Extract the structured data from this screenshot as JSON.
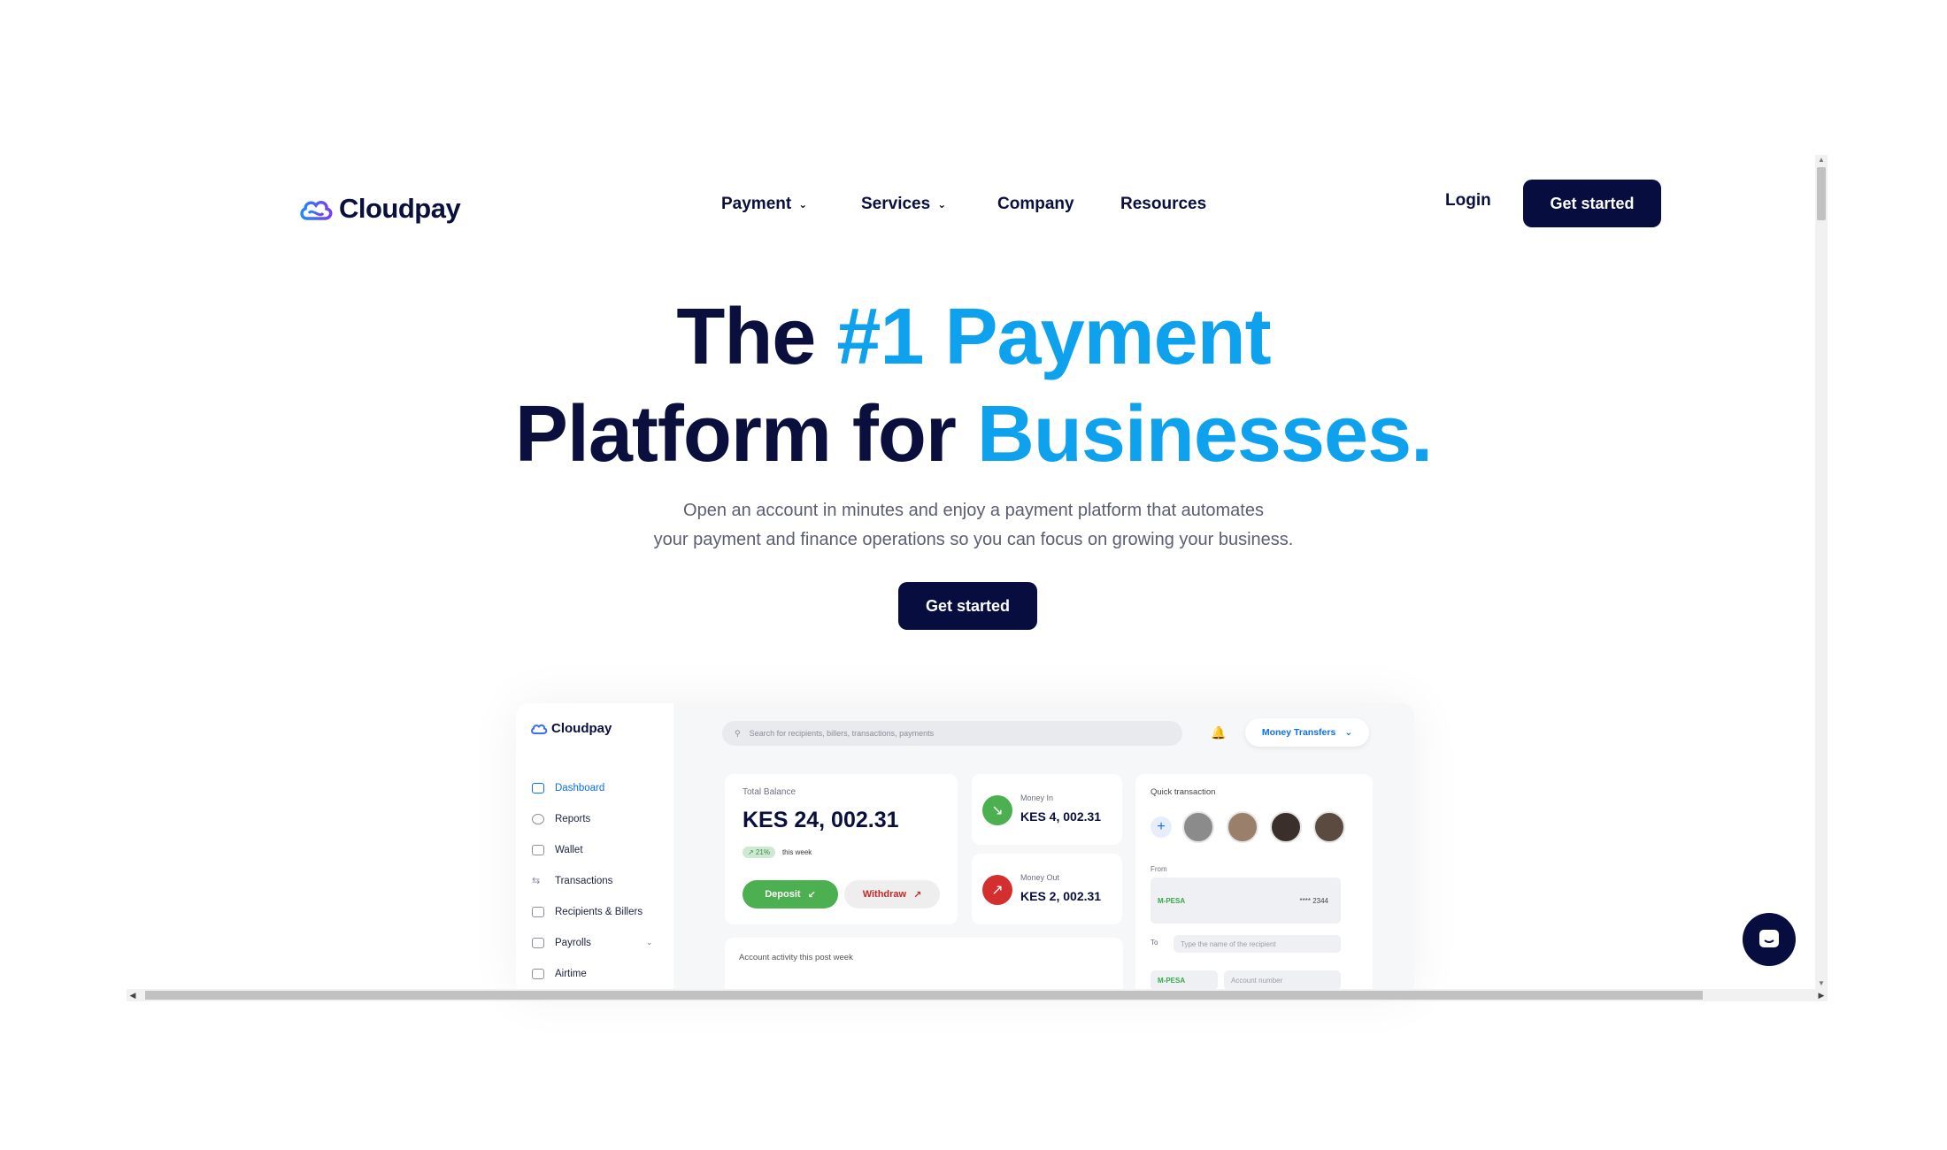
{
  "header": {
    "logo_text": "Cloudpay",
    "nav": [
      {
        "label": "Payment",
        "has_dropdown": true
      },
      {
        "label": "Services",
        "has_dropdown": true
      },
      {
        "label": "Company",
        "has_dropdown": false
      },
      {
        "label": "Resources",
        "has_dropdown": false
      }
    ],
    "login_label": "Login",
    "cta_label": "Get started"
  },
  "hero": {
    "line1_a": "The",
    "line1_b": "#1 Payment",
    "line2_a": "Platform for",
    "line2_b": "Businesses.",
    "subtitle_1": "Open an account in minutes and enjoy a payment platform that automates",
    "subtitle_2": "your payment and finance operations so you can focus on growing your business.",
    "cta_label": "Get started"
  },
  "dashboard": {
    "logo_text": "Cloudpay",
    "sidebar": [
      {
        "label": "Dashboard",
        "active": true
      },
      {
        "label": "Reports"
      },
      {
        "label": "Wallet"
      },
      {
        "label": "Transactions"
      },
      {
        "label": "Recipients & Billers"
      },
      {
        "label": "Payrolls"
      },
      {
        "label": "Airtime"
      }
    ],
    "search_placeholder": "Search for recipients, billers, transactions, payments",
    "transfer_select": "Money Transfers",
    "total_balance_label": "Total Balance",
    "total_balance": "KES 24, 002.31",
    "growth_badge": "↗ 21%",
    "growth_period": "this week",
    "deposit_label": "Deposit",
    "withdraw_label": "Withdraw",
    "money_in_label": "Money In",
    "money_in": "KES 4, 002.31",
    "money_out_label": "Money Out",
    "money_out": "KES 2, 002.31",
    "quick_title": "Quick transaction",
    "from_label": "From",
    "from_provider": "M-PESA",
    "from_account": "**** 2344",
    "to_label": "To",
    "to_placeholder": "Type the name of the recipient",
    "to_provider": "M-PESA",
    "account_placeholder": "Account number",
    "activity_title": "Account activity this post week"
  },
  "colors": {
    "navy": "#070d3f",
    "accent_blue": "#0ea1ee",
    "green": "#4caf50",
    "red": "#d32f2f"
  }
}
